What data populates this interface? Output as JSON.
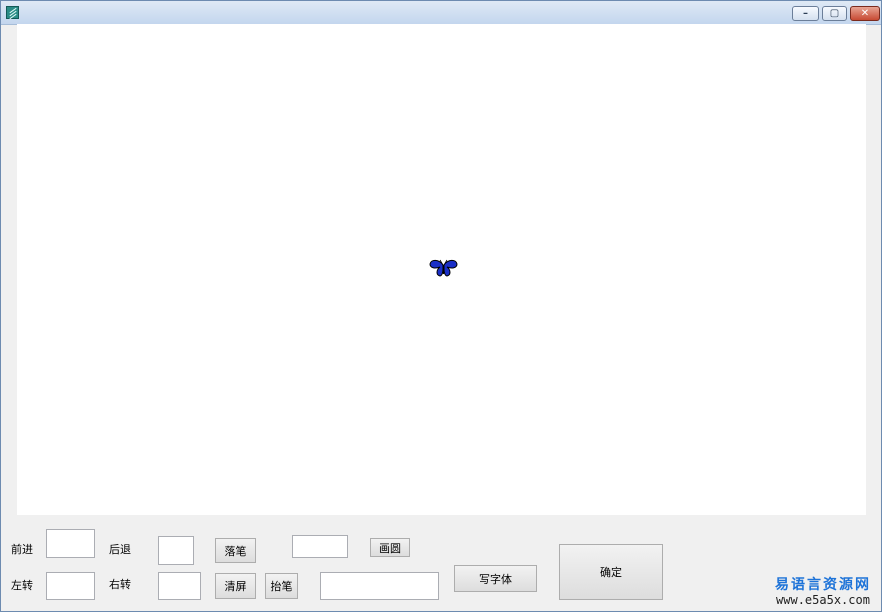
{
  "window": {
    "title": "",
    "controls": {
      "minimize": "–",
      "maximize": "▢",
      "close": "✕"
    }
  },
  "canvas": {
    "turtle_icon": "butterfly-icon",
    "turtle_color": "#1a2fc7"
  },
  "controls": {
    "forward_label": "前进",
    "forward_value": "",
    "back_label": "后退",
    "back_value": "",
    "pen_down_button": "落笔",
    "circle_value": "",
    "circle_button": "画圆",
    "left_label": "左转",
    "left_value": "",
    "right_label": "右转",
    "right_value": "",
    "clear_button": "清屏",
    "pen_up_button": "抬笔",
    "text_value": "",
    "write_text_button": "写字体",
    "confirm_button": "确定"
  },
  "watermark": {
    "line1": "易语言资源网",
    "line2": "www.e5a5x.com"
  }
}
